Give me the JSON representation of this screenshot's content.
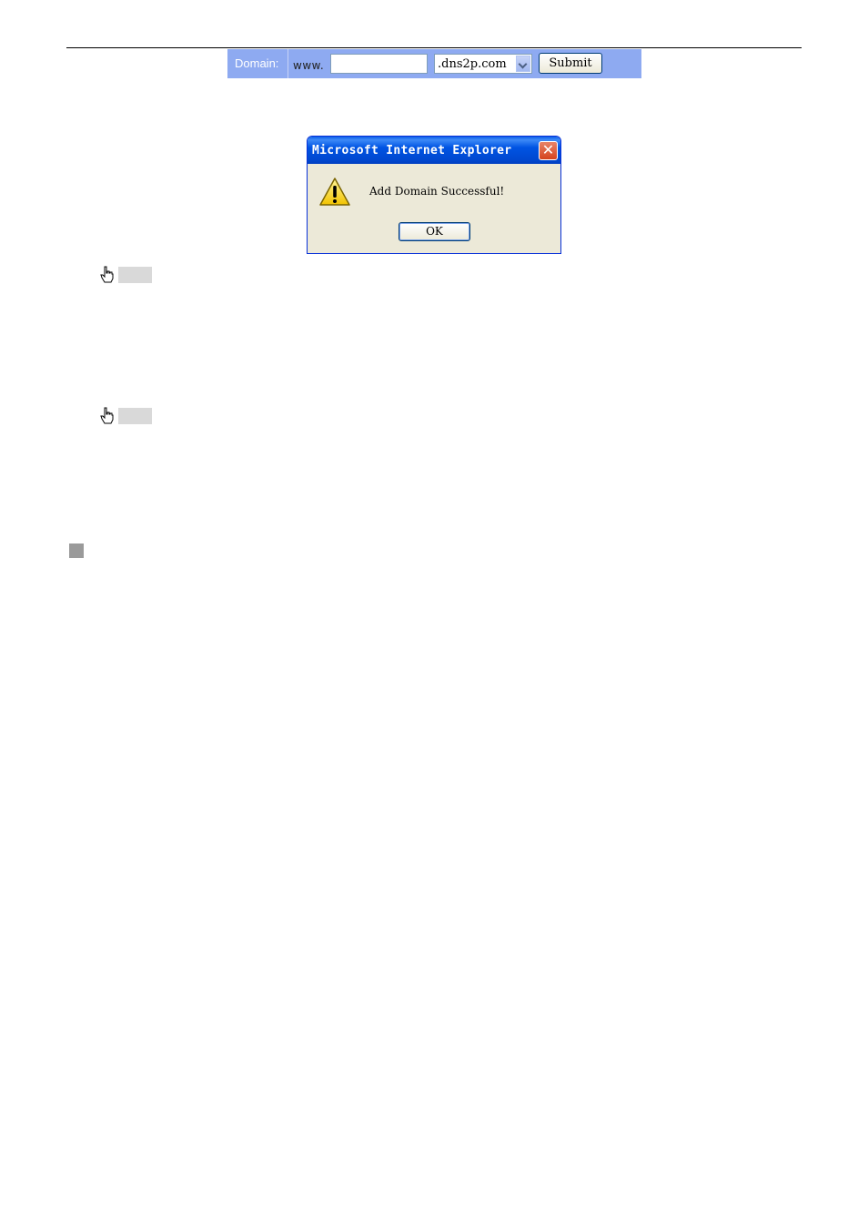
{
  "domain_form": {
    "label": "Domain:",
    "prefix": "www.",
    "input_value": "",
    "suffix_selected": ".dns2p.com",
    "submit_label": "Submit"
  },
  "dialog": {
    "title": "Microsoft Internet Explorer",
    "close_symbol": "✕",
    "message": "Add Domain Successful!",
    "ok_label": "OK",
    "icon": "warning-icon"
  },
  "notes": [
    {
      "icon": "pointer-hand-icon"
    },
    {
      "icon": "pointer-hand-icon"
    }
  ],
  "colors": {
    "form_bar": "#8eaaf1",
    "dialog_titlebar": "#0054e3",
    "dialog_body": "#ece9d8",
    "close_button": "#d4431e"
  }
}
